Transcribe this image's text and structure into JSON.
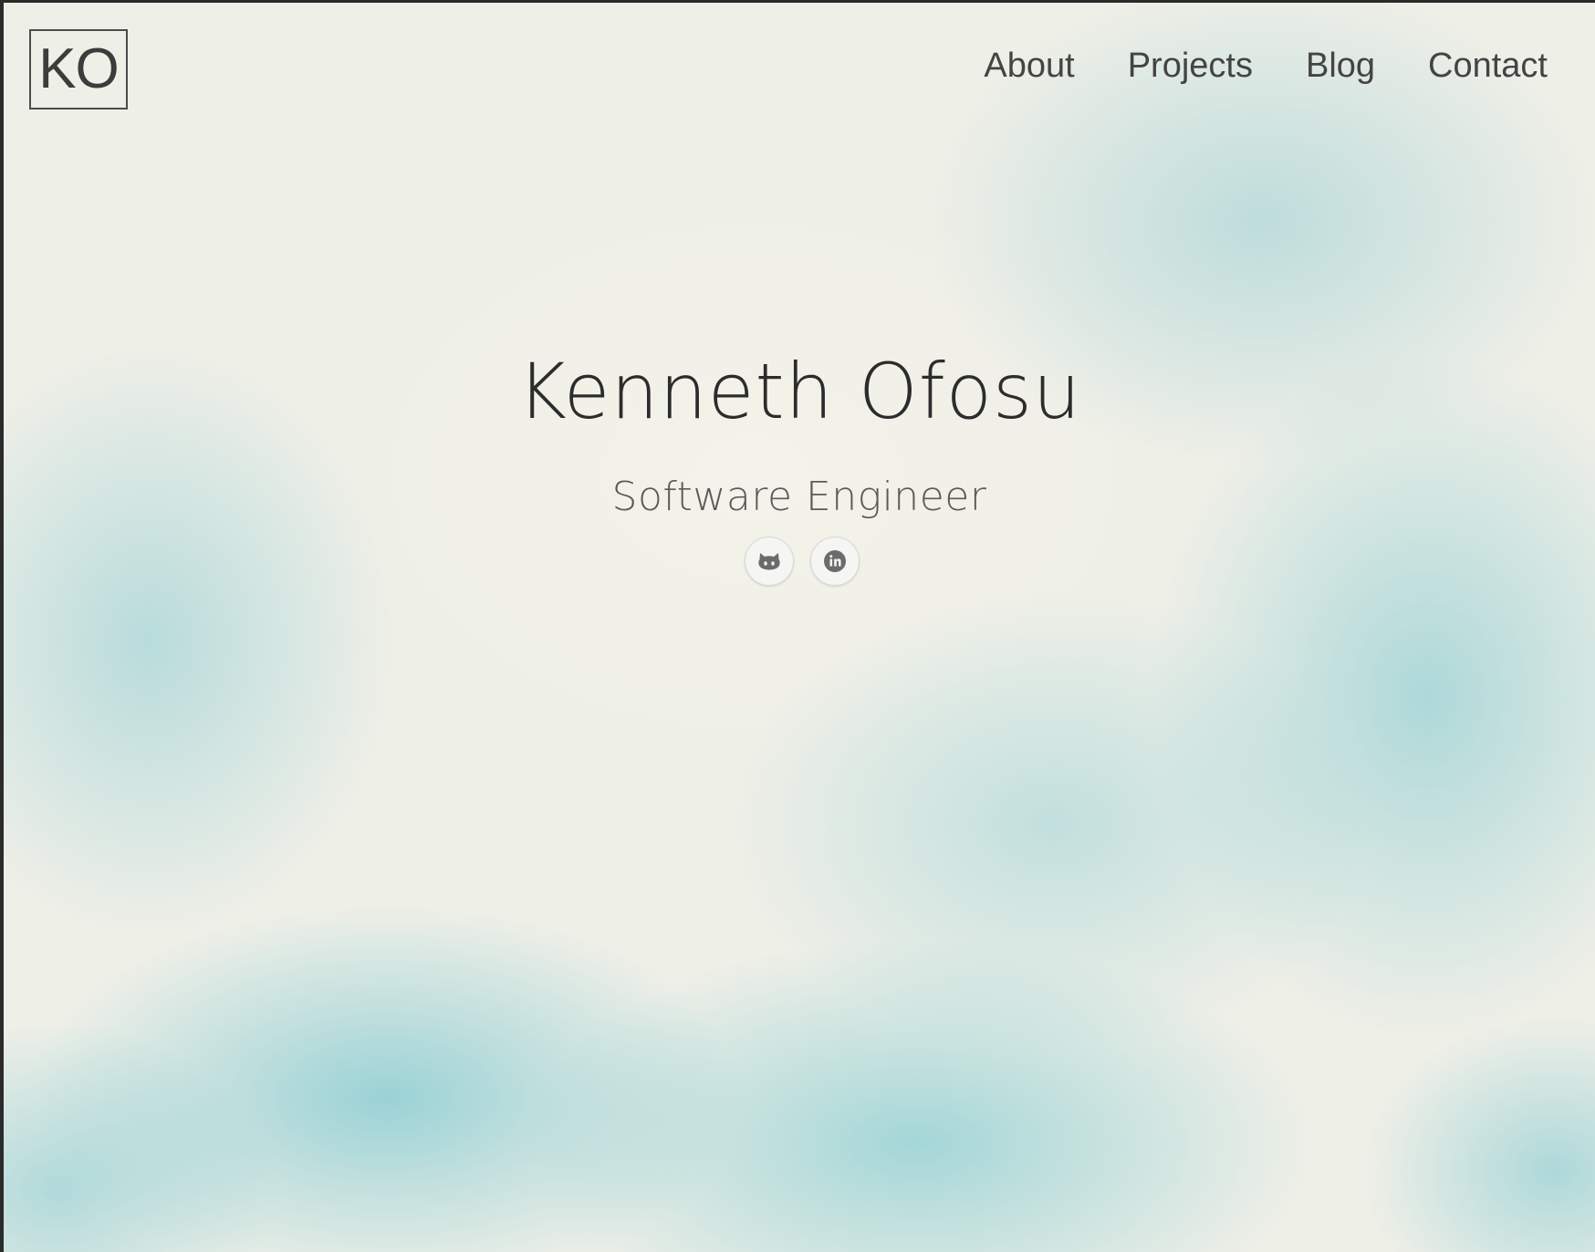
{
  "brand": {
    "logo_text": "KO"
  },
  "nav": {
    "items": [
      {
        "label": "About"
      },
      {
        "label": "Projects"
      },
      {
        "label": "Blog"
      },
      {
        "label": "Contact"
      }
    ]
  },
  "hero": {
    "name": "Kenneth Ofosu",
    "title": "Software Engineer"
  },
  "socials": [
    {
      "icon": "github-icon"
    },
    {
      "icon": "linkedin-icon"
    }
  ],
  "colors": {
    "background": "#eeefe7",
    "watercolor_accent": "#78c6cd",
    "text_dark": "#2c2c2c",
    "text_muted": "#5a5a5a",
    "icon_gray": "#6b6b6b"
  }
}
